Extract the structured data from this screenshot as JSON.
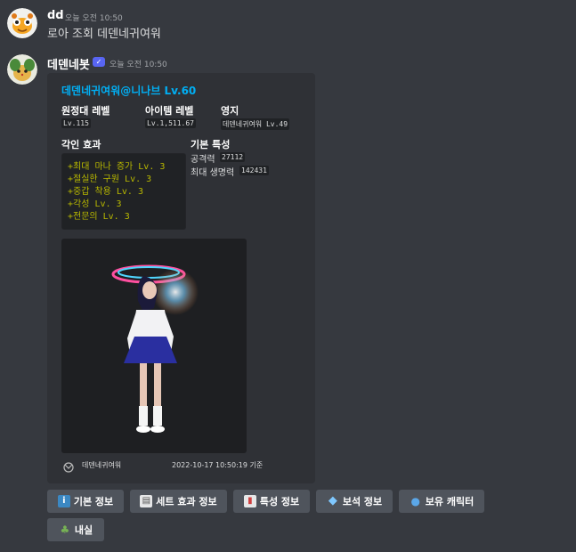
{
  "message1": {
    "username": "dd",
    "timestamp": "오늘 오전 10:50",
    "content": "로아 조회 데덴네귀여워"
  },
  "message2": {
    "username": "데덴네봇",
    "badge": "✓",
    "timestamp": "오늘 오전 10:50"
  },
  "embed": {
    "title": "데덴네귀여워@니나브 Lv.60",
    "fields": {
      "expedition_label": "원정대 레벨",
      "expedition_value": "Lv.115",
      "item_label": "아이템 레벨",
      "item_value": "Lv.1,511.67",
      "estate_label": "영지",
      "estate_value": "데덴네귀여워 Lv.49",
      "engraving_label": "각인 효과",
      "engravings": [
        "+최대 마나 증가 Lv. 3",
        "+절실한 구원 Lv. 3",
        "+중갑 착용 Lv. 3",
        "+각성 Lv. 3",
        "+전문의 Lv. 3"
      ],
      "stats_label": "기본 특성",
      "attack_label": "공격력",
      "attack_value": "27112",
      "hp_label": "최대 생명력",
      "hp_value": "142431"
    },
    "footer": {
      "name": "데덴네귀여워",
      "datetime": "2022-10-17 10:50:19 기준"
    }
  },
  "buttons": [
    {
      "label": "기본 정보",
      "icon": "info-icon"
    },
    {
      "label": "세트 효과 정보",
      "icon": "page-icon"
    },
    {
      "label": "특성 정보",
      "icon": "bar-chart-icon"
    },
    {
      "label": "보석 정보",
      "icon": "gem-icon"
    },
    {
      "label": "보유 캐릭터",
      "icon": "person-icon"
    },
    {
      "label": "내실",
      "icon": "seedling-icon"
    }
  ],
  "colors": {
    "background": "#36393f",
    "embed_bg": "#2f3136",
    "title": "#00aff4",
    "button": "#4f545c",
    "code_text": "#b8b800"
  }
}
